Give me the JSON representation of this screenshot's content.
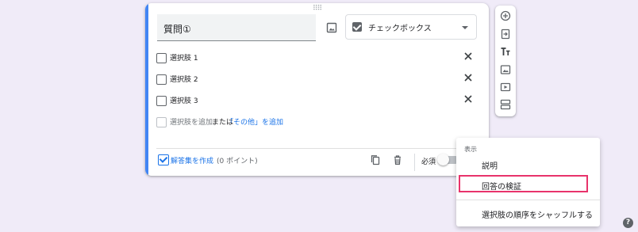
{
  "question": {
    "title": "質問①",
    "type_label": "チェックボックス"
  },
  "options": [
    {
      "label": "選択肢 1"
    },
    {
      "label": "選択肢 2"
    },
    {
      "label": "選択肢 3"
    }
  ],
  "add_option": {
    "label": "選択肢を追加",
    "or": "または",
    "other": "「その他」を追加"
  },
  "footer": {
    "answer_key": "解答集を作成",
    "points": "(0 ポイント)",
    "required": "必須"
  },
  "menu": {
    "header": "表示",
    "items": [
      {
        "label": "説明"
      },
      {
        "label": "回答の検証"
      },
      {
        "label": "選択肢の順序をシャッフルする"
      }
    ]
  },
  "help_glyph": "?",
  "colors": {
    "accent": "#4285f4",
    "link": "#1a73e8",
    "highlight": "#e8336b",
    "background": "#f0ebf8"
  },
  "icons": [
    "image-icon",
    "close-icon",
    "copy-icon",
    "delete-icon",
    "add-circle-icon",
    "import-icon",
    "title-icon",
    "image-icon",
    "video-icon",
    "section-icon",
    "help-icon"
  ]
}
